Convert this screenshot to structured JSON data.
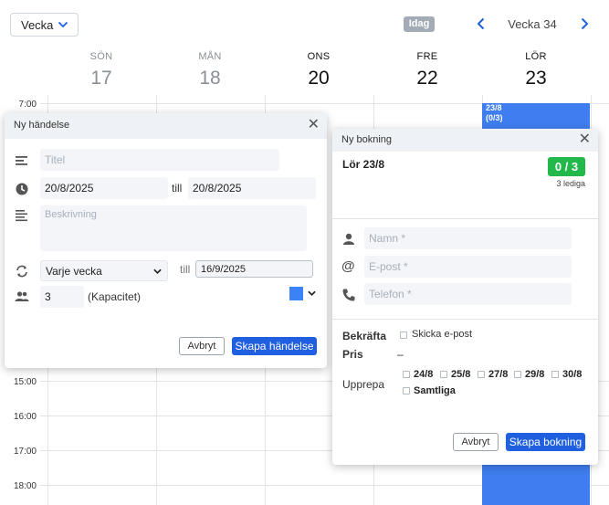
{
  "toolbar": {
    "view_value": "Vecka",
    "today_label": "Idag",
    "week_label": "Vecka 34"
  },
  "days": [
    {
      "name": "SÖN",
      "num": "17"
    },
    {
      "name": "MÅN",
      "num": "18"
    },
    {
      "name": "ONS",
      "num": "20"
    },
    {
      "name": "FRE",
      "num": "22"
    },
    {
      "name": "LÖR",
      "num": "23"
    }
  ],
  "times": [
    "7:00",
    "15:00",
    "16:00",
    "17:00",
    "18:00"
  ],
  "calendar_event": {
    "date": "23/8",
    "count": "(0/3)",
    "color": "#3f7ef0"
  },
  "event_modal": {
    "title": "Ny händelse",
    "title_placeholder": "Titel",
    "start_date": "20/8/2025",
    "till_label": "till",
    "end_date": "20/8/2025",
    "description_placeholder": "Beskrivning",
    "repeat_value": "Varje vecka",
    "repeat_till_label": "till",
    "repeat_end": "16/9/2025",
    "capacity_value": "3",
    "capacity_label": "(Kapacitet)",
    "color": "#3b82f6",
    "cancel_label": "Avbryt",
    "create_label": "Skapa händelse"
  },
  "booking_modal": {
    "title": "Ny bokning",
    "date_heading": "Lör 23/8",
    "capacity_badge": "0 / 3",
    "free_label": "3 lediga",
    "name_placeholder": "Namn *",
    "email_placeholder": "E-post *",
    "phone_placeholder": "Telefon *",
    "confirm_label": "Bekräfta",
    "send_email_label": "Skicka e-post",
    "price_label": "Pris",
    "price_value": "–",
    "repeat_label": "Upprepa",
    "repeat_dates": [
      "24/8",
      "25/8",
      "27/8",
      "29/8",
      "30/8"
    ],
    "all_label": "Samtliga",
    "cancel_label": "Avbryt",
    "submit_label": "Skapa bokning"
  }
}
